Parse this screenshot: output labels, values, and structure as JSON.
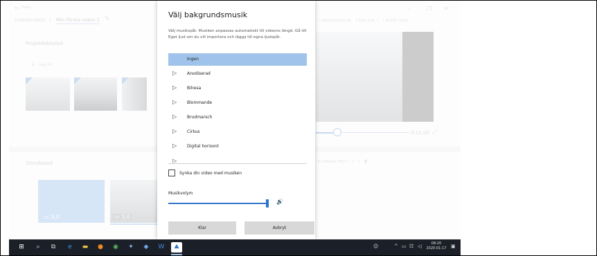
{
  "app": {
    "window_title": "Foton",
    "breadcrumb": [
      "Videoprojekt",
      "Min första video 1"
    ],
    "toolbar": {
      "background_music": "Bakgrundsmusik",
      "custom_audio": "Eget ljud",
      "finish_video": "Slutför video",
      "more": "···"
    },
    "library": {
      "title": "Projektbibliotek",
      "add_label": "Lägg till"
    },
    "playback": {
      "time": "0:12,00"
    },
    "storyboard": {
      "title": "Storyboard",
      "tools": "3D-effekter   Filter   |",
      "clips": [
        {
          "label": "3,0"
        },
        {
          "label": "3,0"
        }
      ]
    }
  },
  "dialog": {
    "title": "Välj bakgrundsmusik",
    "description": "Välj musikspår. Musiken anpassas automatiskt till videons längd. Gå till Eget ljud om du vill importera och lägga till egna ljudspår.",
    "tracks": [
      {
        "name": "Ingen",
        "selected": true
      },
      {
        "name": "Anodiserad",
        "selected": false
      },
      {
        "name": "Bilresa",
        "selected": false
      },
      {
        "name": "Blommande",
        "selected": false
      },
      {
        "name": "Brudmarsch",
        "selected": false
      },
      {
        "name": "Cirkus",
        "selected": false
      },
      {
        "name": "Digital horisont",
        "selected": false
      }
    ],
    "sync_label": "Synka din video med musiken",
    "sync_checked": false,
    "volume_label": "Musikvolym",
    "volume_value": 0.95,
    "ok_label": "Klar",
    "cancel_label": "Avbryt"
  },
  "taskbar": {
    "time": "08:20",
    "date": "2020-01-17"
  },
  "icons": {
    "play": "play-triangle-icon",
    "speaker": "speaker-icon"
  },
  "colors": {
    "accent": "#2f73c8",
    "selection": "#9fc3ea",
    "taskbar": "#1b1f28"
  }
}
